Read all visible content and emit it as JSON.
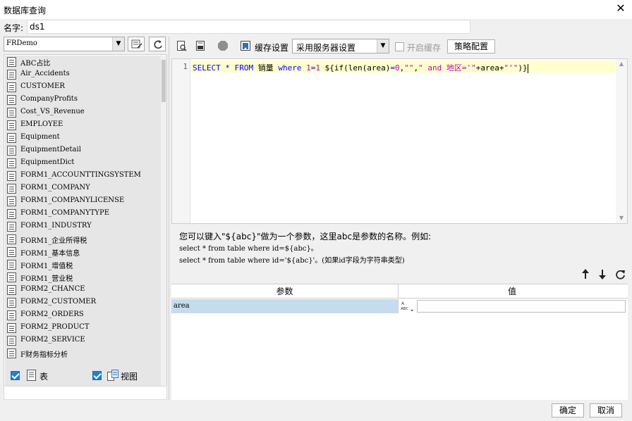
{
  "window": {
    "title": "数据库查询"
  },
  "name_field": {
    "label": "名字:",
    "value": "ds1"
  },
  "left_panel": {
    "connection": "FRDemo",
    "tables": [
      "ABC占比",
      "Air_Accidents",
      "CUSTOMER",
      "CompanyProfits",
      "Cost_VS_Revenue",
      "EMPLOYEE",
      "Equipment",
      "EquipmentDetail",
      "EquipmentDict",
      "FORM1_ACCOUNTTINGSYSTEM",
      "FORM1_COMPANY",
      "FORM1_COMPANYLICENSE",
      "FORM1_COMPANYTYPE",
      "FORM1_INDUSTRY",
      "FORM1_企业所得税",
      "FORM1_基本信息",
      "FORM1_增值税",
      "FORM1_营业税",
      "FORM2_CHANCE",
      "FORM2_CUSTOMER",
      "FORM2_ORDERS",
      "FORM2_PRODUCT",
      "FORM2_SERVICE",
      "F财务指标分析"
    ],
    "show_table_label": "表",
    "show_view_label": "视图"
  },
  "right_panel": {
    "cache_label": "缓存设置",
    "cache_option": "采用服务器设置",
    "enable_cache_label": "开启缓存",
    "policy_button": "策略配置",
    "editor": {
      "line_number": "1",
      "sql": {
        "t1": "SELECT",
        "t2": " * ",
        "t3": "FROM",
        "t4": " 销量 ",
        "t5": "where",
        "t6": " ",
        "t7": "1",
        "t8": "=",
        "t9": "1",
        "t10": " ${if(len(area)",
        "t11": "=",
        "t12": "0",
        "t13": ",",
        "t14": "\"\"",
        "t15": ",",
        "t16": "\" and 地区='\"",
        "t17": "+area+",
        "t18": "\"'\"",
        "t19": ")}"
      }
    },
    "help": {
      "line1": "您可以键入\"${abc}\"做为一个参数，这里abc是参数的名称。例如:",
      "line2": "select * from table where id=${abc}。",
      "line3": "select * from table where id='${abc}'。(如果id字段为字符串类型)"
    },
    "params_table": {
      "headers": [
        "参数",
        "值"
      ],
      "rows": [
        {
          "param": "area",
          "value": ""
        }
      ]
    }
  },
  "footer": {
    "ok": "确定",
    "cancel": "取消"
  }
}
